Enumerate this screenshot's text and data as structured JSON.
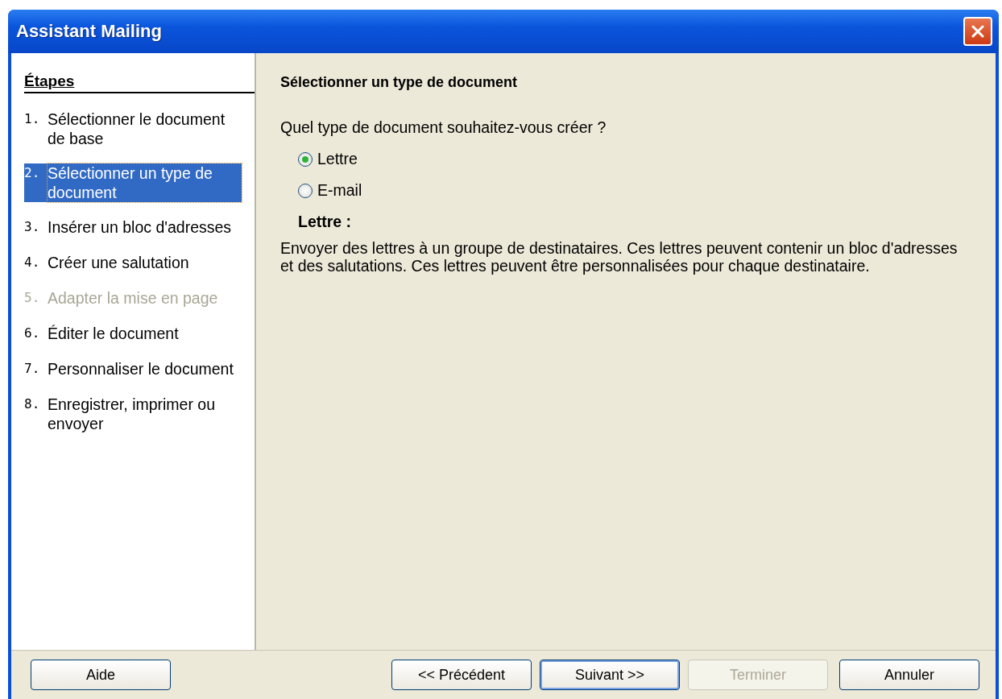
{
  "window": {
    "title": "Assistant Mailing"
  },
  "sidebar": {
    "heading": "Étapes",
    "items": [
      {
        "number": "1.",
        "label": "Sélectionner le document de base",
        "selected": false,
        "disabled": false
      },
      {
        "number": "2.",
        "label": "Sélectionner un type de document",
        "selected": true,
        "disabled": false
      },
      {
        "number": "3.",
        "label": "Insérer un bloc d'adresses",
        "selected": false,
        "disabled": false
      },
      {
        "number": "4.",
        "label": "Créer une salutation",
        "selected": false,
        "disabled": false
      },
      {
        "number": "5.",
        "label": "Adapter la mise en page",
        "selected": false,
        "disabled": true
      },
      {
        "number": "6.",
        "label": "Éditer le document",
        "selected": false,
        "disabled": false
      },
      {
        "number": "7.",
        "label": "Personnaliser le document",
        "selected": false,
        "disabled": false
      },
      {
        "number": "8.",
        "label": "Enregistrer, imprimer ou envoyer",
        "selected": false,
        "disabled": false
      }
    ]
  },
  "content": {
    "heading": "Sélectionner un type de document",
    "question": "Quel type de document souhaitez-vous créer ?",
    "options": [
      {
        "label": "Lettre",
        "selected": true
      },
      {
        "label": "E-mail",
        "selected": false
      }
    ],
    "description_title": "Lettre :",
    "description": "Envoyer des lettres à un groupe de destinataires. Ces lettres peuvent contenir un bloc d'adresses et des salutations. Ces lettres peuvent être personnalisées pour chaque destinataire."
  },
  "buttons": [
    {
      "label": "Aide",
      "kind": "help",
      "disabled": false,
      "default": false
    },
    {
      "label": "<< Précédent",
      "kind": "nav",
      "disabled": false,
      "default": false
    },
    {
      "label": "Suivant >>",
      "kind": "nav",
      "disabled": false,
      "default": true
    },
    {
      "label": "Terminer",
      "kind": "nav",
      "disabled": true,
      "default": false
    },
    {
      "label": "Annuler",
      "kind": "cancel",
      "disabled": false,
      "default": false
    }
  ]
}
